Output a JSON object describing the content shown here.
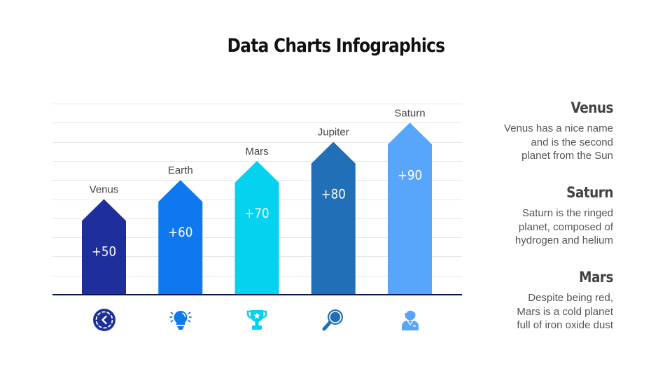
{
  "header": {
    "title": "Data Charts Infographics"
  },
  "chart_data": {
    "type": "bar",
    "style": "arrow-columns",
    "title": "Data Charts Infographics",
    "categories": [
      "Venus",
      "Earth",
      "Mars",
      "Jupiter",
      "Saturn"
    ],
    "values": [
      50,
      60,
      70,
      80,
      90
    ],
    "value_labels": [
      "+50",
      "+60",
      "+70",
      "+80",
      "+90"
    ],
    "colors": [
      "#1e2f9c",
      "#0f78ee",
      "#05d2ee",
      "#216fb7",
      "#58a6fb"
    ],
    "icons": [
      "clock-back-icon",
      "lightbulb-icon",
      "trophy-icon",
      "magnifier-icon",
      "person-icon"
    ],
    "ylim": [
      0,
      100
    ],
    "grid_step": 10,
    "grid": true,
    "axis_color": "#0b1550",
    "grid_color": "#e6e6e6",
    "xlabel": "",
    "ylabel": ""
  },
  "side_notes": [
    {
      "title": "Venus",
      "text": "Venus has a nice name\nand is the second\nplanet from the Sun"
    },
    {
      "title": "Saturn",
      "text": "Saturn is the ringed\nplanet, composed  of\nhydrogen and helium"
    },
    {
      "title": "Mars",
      "text": "Despite being red,\nMars is a cold planet\nfull of iron oxide dust"
    }
  ]
}
